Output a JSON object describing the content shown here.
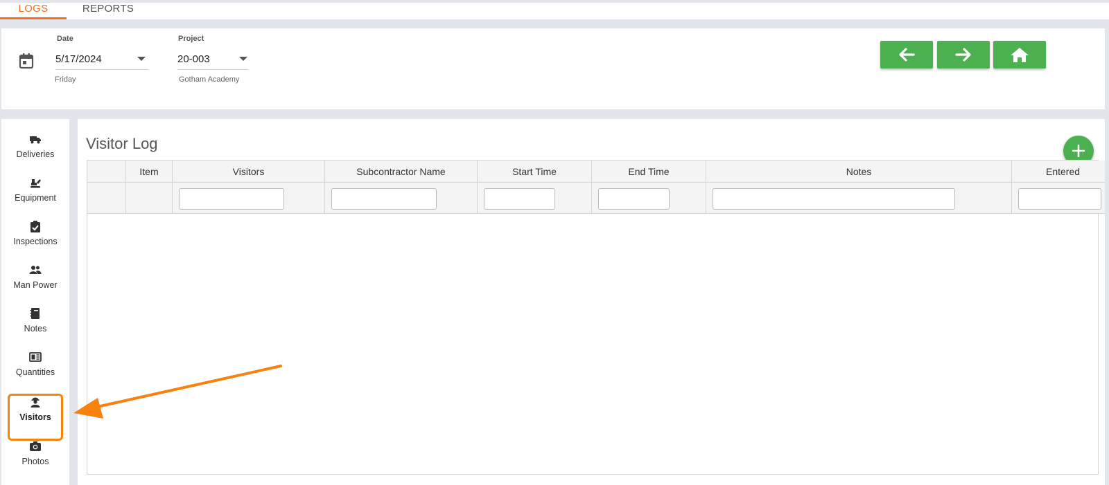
{
  "tabs": [
    {
      "label": "LOGS",
      "active": true
    },
    {
      "label": "REPORTS",
      "active": false
    }
  ],
  "header": {
    "date_label": "Date",
    "date_value": "5/17/2024",
    "date_sub": "Friday",
    "project_label": "Project",
    "project_value": "20-003",
    "project_sub": "Gotham Academy"
  },
  "nav_buttons": [
    "arrow-left-icon",
    "arrow-right-icon",
    "home-icon"
  ],
  "sidebar": {
    "items": [
      {
        "label": "Deliveries",
        "icon": "truck-icon"
      },
      {
        "label": "Equipment",
        "icon": "excavator-icon"
      },
      {
        "label": "Inspections",
        "icon": "clipboard-check-icon"
      },
      {
        "label": "Man Power",
        "icon": "people-icon"
      },
      {
        "label": "Notes",
        "icon": "notebook-icon"
      },
      {
        "label": "Quantities",
        "icon": "quantities-icon"
      },
      {
        "label": "Visitors",
        "icon": "worker-icon",
        "active": true
      },
      {
        "label": "Photos",
        "icon": "camera-icon"
      }
    ]
  },
  "main": {
    "title": "Visitor Log",
    "columns": [
      "",
      "Item",
      "Visitors",
      "Subcontractor Name",
      "Start Time",
      "End Time",
      "Notes",
      "Entered"
    ]
  },
  "colors": {
    "accent_orange": "#f26d21",
    "highlight_orange": "#f7820f",
    "primary_green": "#4caf50"
  }
}
